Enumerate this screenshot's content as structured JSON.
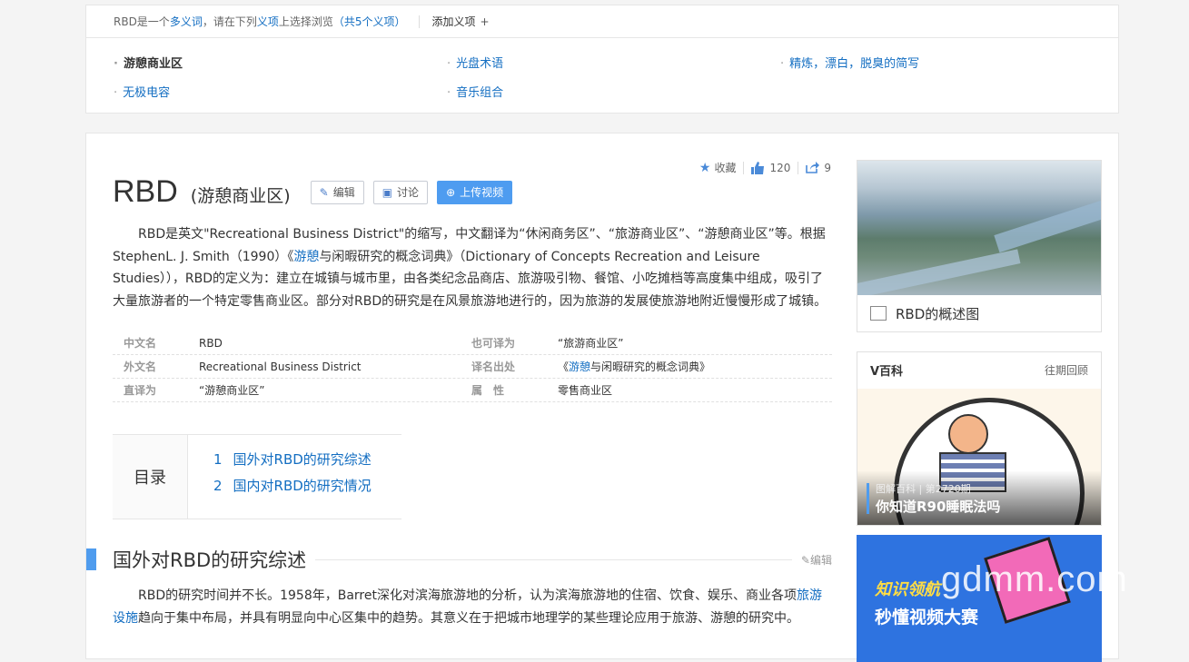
{
  "disambig": {
    "prefix": "RBD是一个",
    "word": "多义词",
    "mid": "，请在下列",
    "choice": "义项",
    "mid2": "上选择浏览",
    "count": "（共5个义项）",
    "add_label": "添加义项",
    "add_icon": "+",
    "items": [
      {
        "label": "游憩商业区"
      },
      {
        "label": "光盘术语"
      },
      {
        "label": "精炼，漂白，脱臭的简写"
      },
      {
        "label": "无极电容"
      },
      {
        "label": "音乐组合"
      }
    ]
  },
  "stats": {
    "collect_label": "收藏",
    "like_count": "120",
    "share_count": "9"
  },
  "title": {
    "main": "RBD",
    "sub": "(游憩商业区)"
  },
  "toolbar": {
    "edit_label": "编辑",
    "discuss_label": "讨论",
    "upload_label": "上传视频"
  },
  "summary": {
    "p1": "RBD是英文\"Recreational Business District\"的缩写，中文翻译为“休闲商务区”、“旅游商业区”、“游憩商业区”等。根据StephenL. J. Smith（1990）《",
    "link": "游憩",
    "p2": "与闲暇研究的概念词典》（Dictionary of Concepts Recreation and Leisure Studies）），RBD的定义为：建立在城镇与城市里，由各类纪念品商店、旅游吸引物、餐馆、小吃摊档等高度集中组成，吸引了大量旅游者的一个特定零售商业区。部分对RBD的研究是在风景旅游地进行的，因为旅游的发展使旅游地附近慢慢形成了城镇。"
  },
  "infobox": {
    "rows": [
      {
        "k1": "中文名",
        "v1": "RBD",
        "k2": "也可译为",
        "v2": "“旅游商业区”"
      },
      {
        "k1": "外文名",
        "v1": "Recreational Business District",
        "k2": "译名出处",
        "v2a": "《",
        "v2link": "游憩",
        "v2b": "与闲暇研究的概念词典》"
      },
      {
        "k1": "直译为",
        "v1": "“游憩商业区”",
        "k2": "属　性",
        "v2": "零售商业区"
      }
    ]
  },
  "toc": {
    "label": "目录",
    "items": [
      {
        "num": "1",
        "text": "国外对RBD的研究综述"
      },
      {
        "num": "2",
        "text": "国内对RBD的研究情况"
      }
    ]
  },
  "section1": {
    "heading": "国外对RBD的研究综述",
    "edit_label": "编辑",
    "p_a": "RBD的研究时间并不长。1958年，Barret深化对滨海旅游地的分析，认为滨海旅游地的住宿、饮食、娱乐、商业各项",
    "p_link": "旅游设施",
    "p_b": "趋向于集中布局，并具有明显向中心区集中的趋势。其意义在于把城市地理学的某些理论应用于旅游、游憩的研究中。"
  },
  "album": {
    "caption": "RBD的概述图"
  },
  "vbaike": {
    "title": "V百科",
    "more": "往期回顾",
    "meta": "图解百科 | 第2720期",
    "video_title": "你知道R90睡眠法吗"
  },
  "promo": {
    "line1": "知识领航",
    "line2": "秒懂视频大赛"
  },
  "watermark": "gdmm.com",
  "icons": [
    "star-icon",
    "thumbs-up-icon",
    "share-icon",
    "pencil-icon",
    "comment-icon",
    "upload-icon",
    "image-icon",
    "plus-icon"
  ],
  "colors": {
    "link": "#136ec2",
    "accent": "#4f9cee",
    "button_blue": "#4e9cf0"
  }
}
